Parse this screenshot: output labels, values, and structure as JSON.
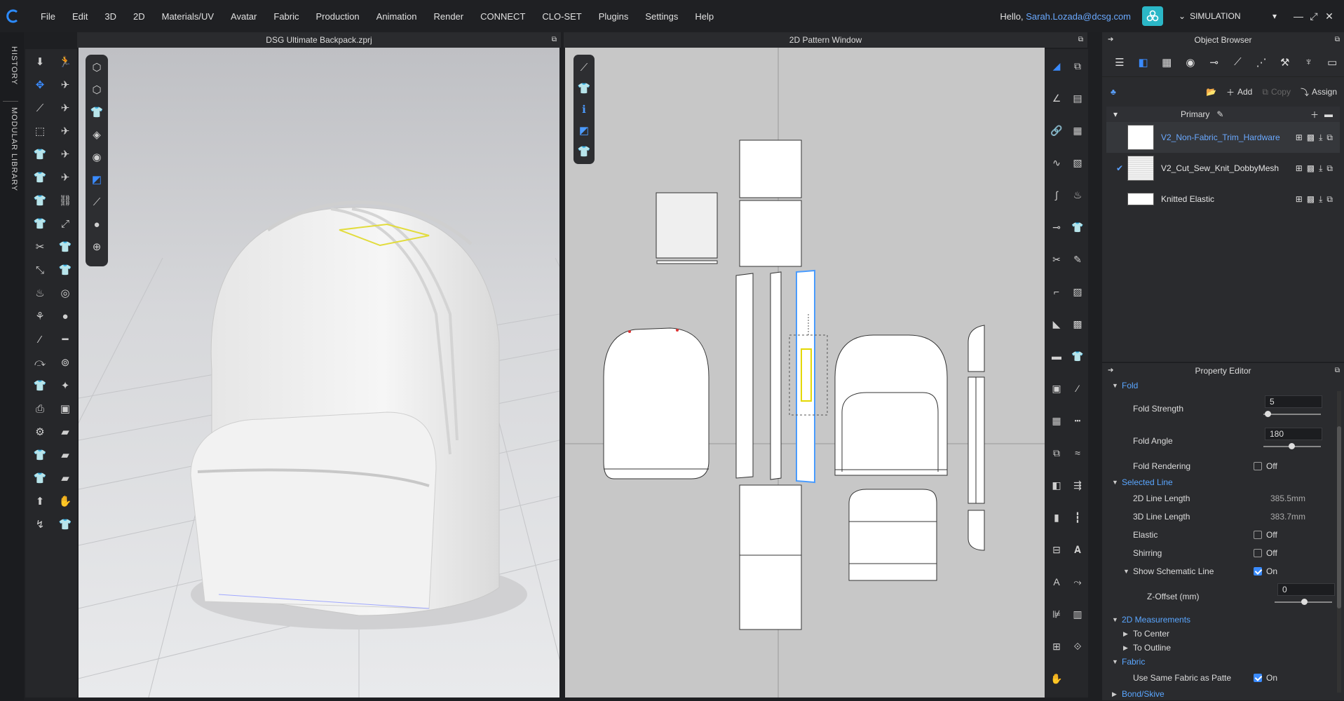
{
  "menu": {
    "items": [
      "File",
      "Edit",
      "3D",
      "2D",
      "Materials/UV",
      "Avatar",
      "Fabric",
      "Production",
      "Animation",
      "Render",
      "CONNECT",
      "CLO-SET",
      "Plugins",
      "Settings",
      "Help"
    ],
    "hello_prefix": "Hello, ",
    "user_email": "Sarah.Lozada@dcsg.com",
    "mode": "SIMULATION"
  },
  "side_tabs": {
    "history": "HISTORY",
    "modular_library": "MODULAR LIBRARY"
  },
  "viewport_3d": {
    "title": "DSG Ultimate Backpack.zprj"
  },
  "pattern_window": {
    "title": "2D Pattern Window"
  },
  "object_browser": {
    "title": "Object Browser",
    "actions": {
      "add": "Add",
      "copy": "Copy",
      "assign": "Assign"
    },
    "group": "Primary",
    "fabrics": [
      {
        "name": "V2_Non-Fabric_Trim_Hardware",
        "selected": true,
        "checked": false
      },
      {
        "name": "V2_Cut_Sew_Knit_DobbyMesh",
        "selected": false,
        "checked": true
      },
      {
        "name": "Knitted Elastic",
        "selected": false,
        "checked": false
      }
    ]
  },
  "property_editor": {
    "title": "Property Editor",
    "fold": {
      "label": "Fold",
      "strength_label": "Fold Strength",
      "strength_value": "5",
      "angle_label": "Fold Angle",
      "angle_value": "180",
      "rendering_label": "Fold Rendering",
      "rendering_value": "Off"
    },
    "selected_line": {
      "label": "Selected Line",
      "len2d_label": "2D Line Length",
      "len2d_value": "385.5mm",
      "len3d_label": "3D Line Length",
      "len3d_value": "383.7mm",
      "elastic_label": "Elastic",
      "elastic_value": "Off",
      "shirring_label": "Shirring",
      "shirring_value": "Off",
      "schematic_label": "Show Schematic Line",
      "schematic_value": "On",
      "zoffset_label": "Z-Offset (mm)",
      "zoffset_value": "0"
    },
    "measurements": {
      "label": "2D Measurements",
      "to_center": "To Center",
      "to_outline": "To Outline"
    },
    "fabric": {
      "label": "Fabric",
      "same_fabric_label": "Use Same Fabric as Patte",
      "same_fabric_value": "On"
    },
    "bond": {
      "label": "Bond/Skive"
    }
  }
}
